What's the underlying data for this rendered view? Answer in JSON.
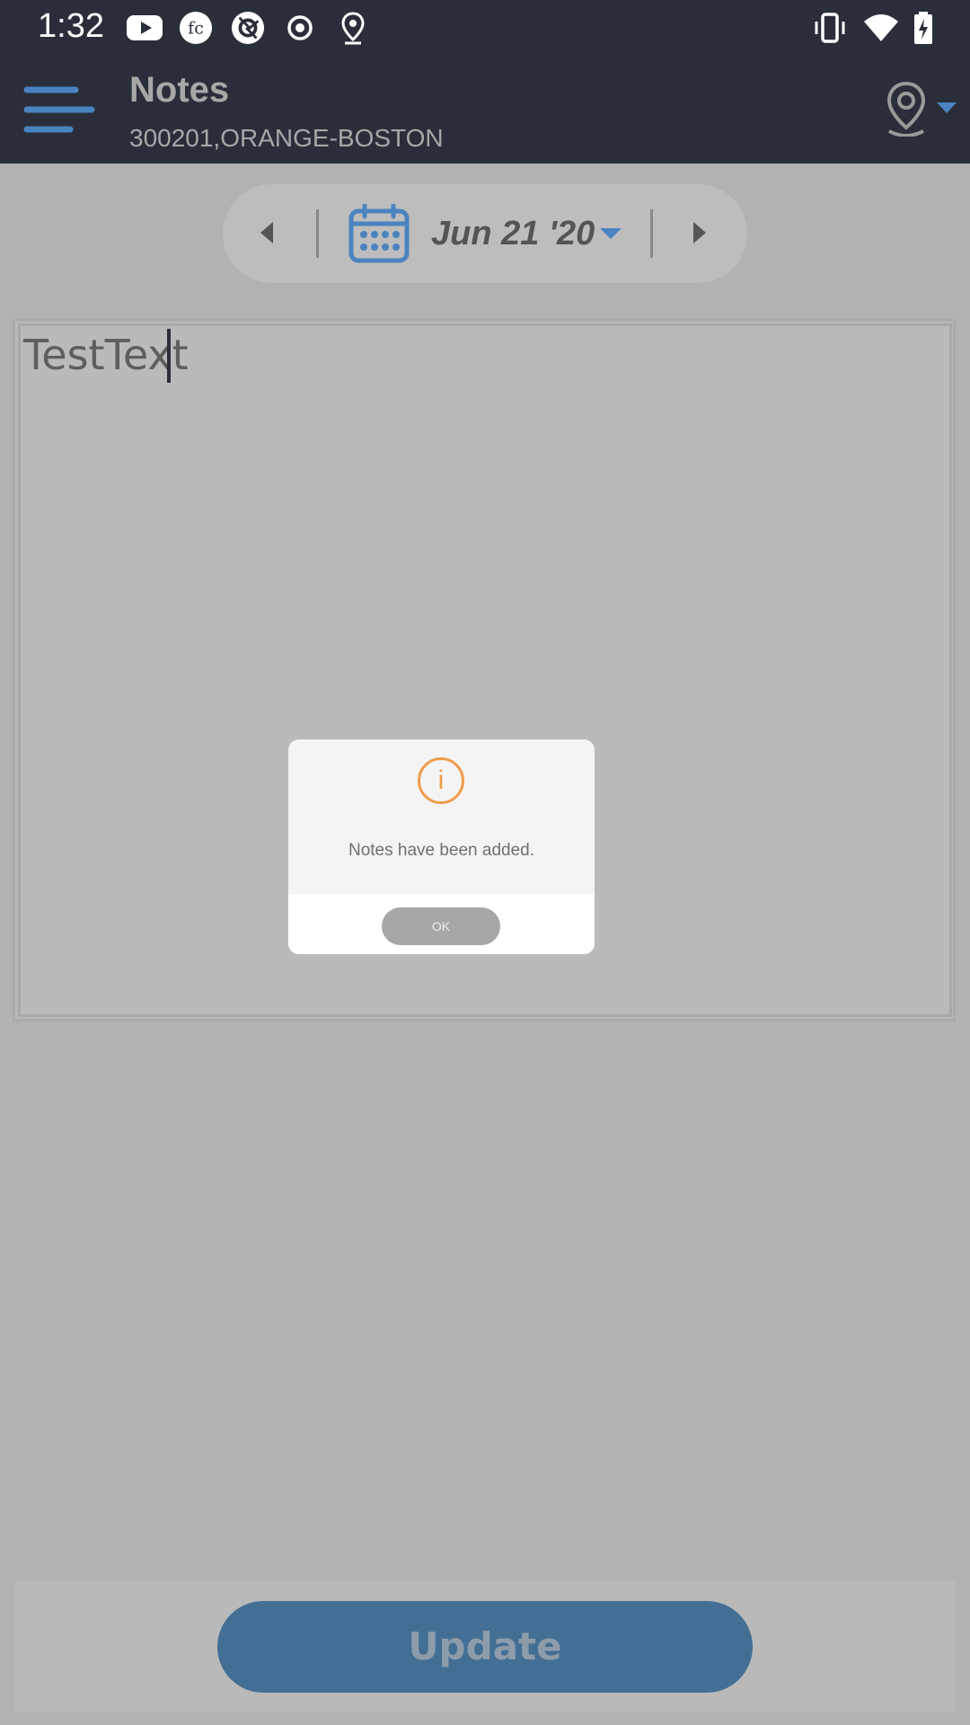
{
  "status_bar": {
    "time": "1:32",
    "icons_left": [
      "youtube-icon",
      "fc-icon",
      "camera-shutter-icon",
      "record-icon",
      "location-pin-icon"
    ],
    "icons_right": [
      "vibrate-icon",
      "wifi-icon",
      "battery-charging-icon"
    ]
  },
  "appbar": {
    "title": "Notes",
    "subtitle": "300201,ORANGE-BOSTON",
    "menu_icon": "hamburger-menu-icon",
    "location_icon": "location-pin-icon"
  },
  "date_selector": {
    "date": "Jun 21 '20",
    "prev_icon": "triangle-left-icon",
    "next_icon": "triangle-right-icon",
    "calendar_icon": "calendar-icon"
  },
  "notes": {
    "text": "TestText"
  },
  "dialog": {
    "icon": "info-icon",
    "icon_glyph": "i",
    "message": "Notes have been added.",
    "ok_label": "OK"
  },
  "update_button": {
    "label": "Update"
  },
  "colors": {
    "appbar_bg": "#2a2e3a",
    "accent_blue": "#4a83c0",
    "info_orange": "#f19c4b",
    "update_button": "#436f94"
  }
}
